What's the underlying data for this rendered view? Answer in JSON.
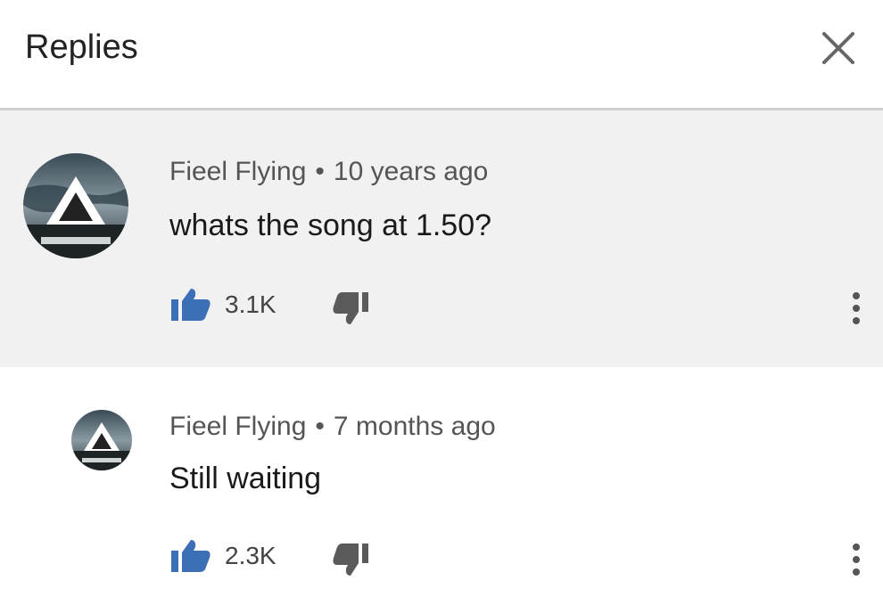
{
  "header": {
    "title": "Replies",
    "close_icon": "close-icon"
  },
  "colors": {
    "like_blue": "#3d6fb7",
    "dislike_gray": "#5a5a5a",
    "thread_bg": "#f1f1f1"
  },
  "comments": [
    {
      "author": "Fieel Flying",
      "separator": "•",
      "time": "10 years ago",
      "text": "whats the song at 1.50?",
      "likes": "3.1K",
      "icons": [
        "thumbs-up-icon",
        "thumbs-down-icon",
        "more-vert-icon"
      ]
    },
    {
      "author": "Fieel Flying",
      "separator": "•",
      "time": "7 months ago",
      "text": "Still waiting",
      "likes": "2.3K",
      "icons": [
        "thumbs-up-icon",
        "thumbs-down-icon",
        "more-vert-icon"
      ]
    }
  ]
}
